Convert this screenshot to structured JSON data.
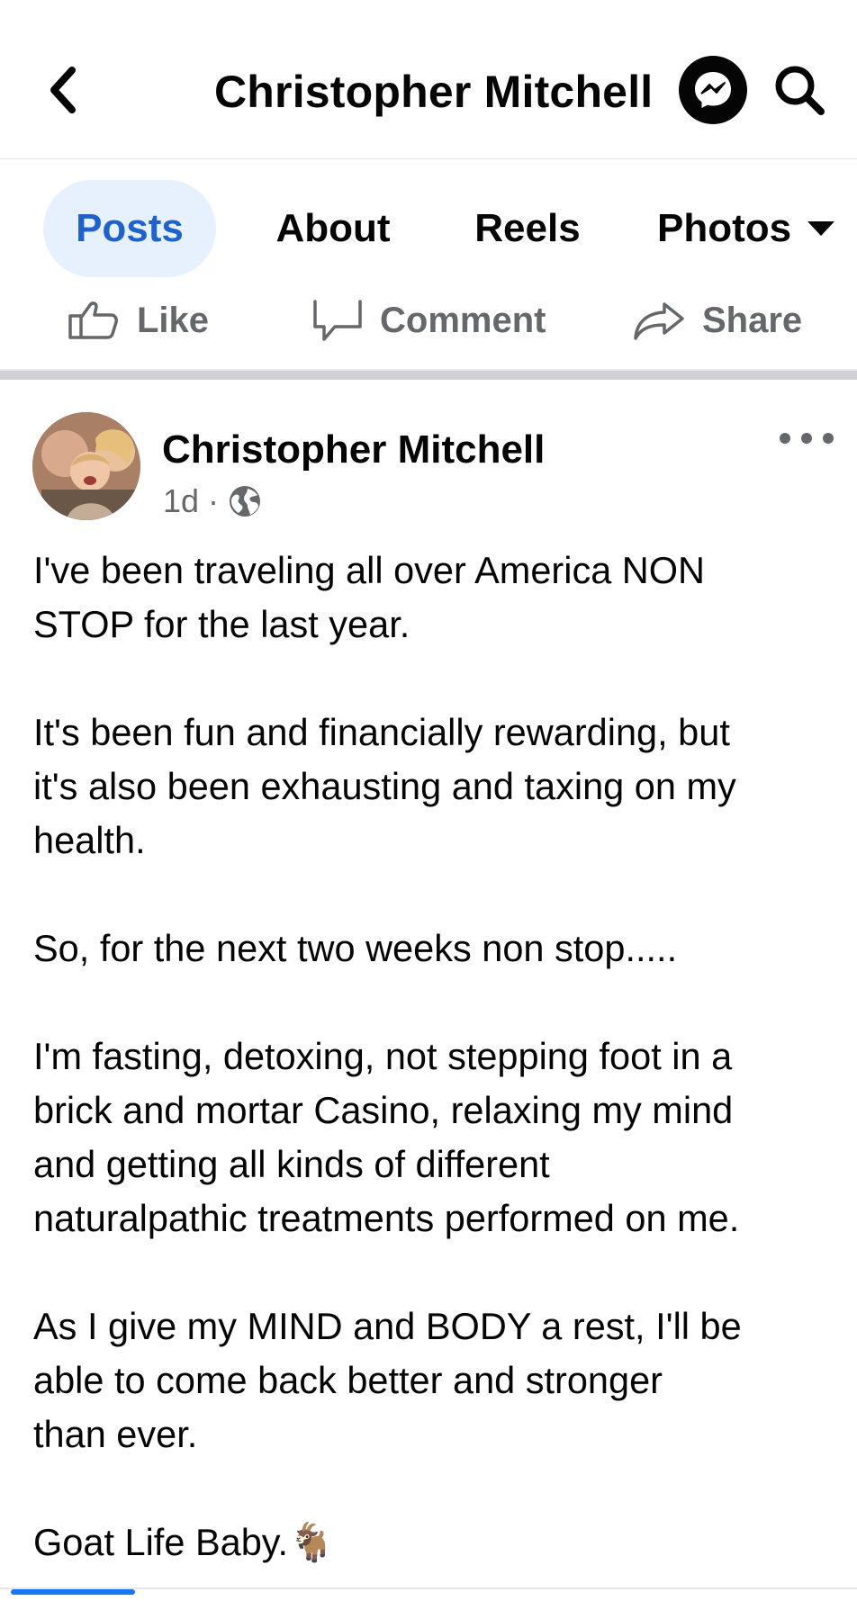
{
  "header": {
    "title": "Christopher Mitchell",
    "back_icon": "chevron-left-icon",
    "messenger_icon": "messenger-icon",
    "search_icon": "search-icon"
  },
  "tabs": [
    {
      "label": "Posts",
      "active": true
    },
    {
      "label": "About"
    },
    {
      "label": "Reels"
    },
    {
      "label": "Photos"
    }
  ],
  "actions": {
    "like": "Like",
    "comment": "Comment",
    "share": "Share"
  },
  "post": {
    "author": "Christopher Mitchell",
    "time": "1d",
    "separator": "·",
    "audience_icon": "globe-icon",
    "paragraphs": [
      [
        "I've been traveling all over America NON",
        "STOP for the last year."
      ],
      [
        "It's been fun and financially rewarding, but",
        "it's also been exhausting and taxing on my",
        "health."
      ],
      [
        "So, for the next two weeks non stop....."
      ],
      [
        "I'm fasting, detoxing, not stepping foot in a",
        "brick and mortar Casino, relaxing my mind",
        "and getting all kinds of different",
        "naturalpathic treatments performed on me."
      ],
      [
        "As I give my MIND and BODY a rest, I'll be",
        "able to come back better and stronger",
        "than ever."
      ],
      [
        "Goat Life Baby.🐐"
      ]
    ]
  },
  "colors": {
    "accent": "#1d63c9",
    "active_tab_bg": "#e7f0fd",
    "muted_text": "#65676b",
    "primary_text": "#050505"
  }
}
